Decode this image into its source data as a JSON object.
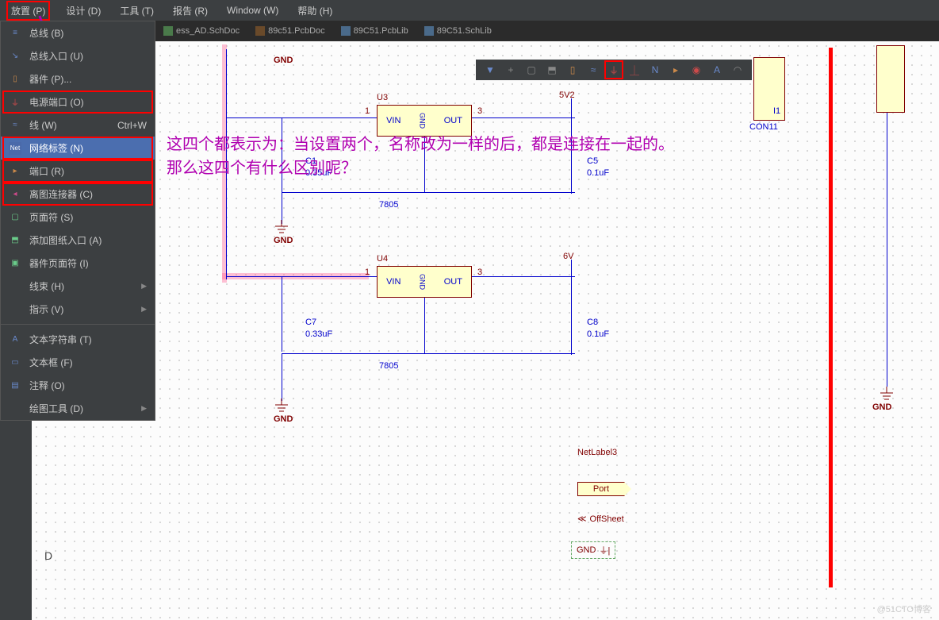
{
  "menubar": [
    {
      "label": "放置 (P)",
      "active": true
    },
    {
      "label": "设计 (D)"
    },
    {
      "label": "工具 (T)"
    },
    {
      "label": "报告 (R)"
    },
    {
      "label": "Window (W)"
    },
    {
      "label": "帮助 (H)"
    }
  ],
  "tabs": [
    {
      "label": "ess_AD.SchDoc",
      "icon": "sch"
    },
    {
      "label": "89c51.PcbDoc",
      "icon": "pcb"
    },
    {
      "label": "89C51.PcbLib",
      "icon": "lib"
    },
    {
      "label": "89C51.SchLib",
      "icon": "lib"
    }
  ],
  "dropdown": [
    {
      "label": "总线 (B)",
      "icon": "bus-icon"
    },
    {
      "label": "总线入口 (U)",
      "icon": "bus-entry-icon"
    },
    {
      "label": "器件 (P)...",
      "icon": "part-icon"
    },
    {
      "label": "电源端口 (O)",
      "icon": "power-port-icon",
      "redbox": true
    },
    {
      "label": "线 (W)",
      "shortcut": "Ctrl+W",
      "icon": "wire-icon"
    },
    {
      "label": "网络标签 (N)",
      "icon": "net-label-icon",
      "highlighted": true,
      "redbox": true
    },
    {
      "label": "端口 (R)",
      "icon": "port-icon",
      "redbox": true
    },
    {
      "label": "离图连接器 (C)",
      "icon": "offsheet-icon",
      "redbox": true
    },
    {
      "label": "页面符 (S)",
      "icon": "sheet-symbol-icon"
    },
    {
      "label": "添加图纸入口 (A)",
      "icon": "sheet-entry-icon"
    },
    {
      "label": "器件页面符 (I)",
      "icon": "device-sheet-icon"
    },
    {
      "label": "线束 (H)",
      "icon": "harness-icon",
      "sub": true
    },
    {
      "label": "指示 (V)",
      "icon": "directive-icon",
      "sub": true
    },
    {
      "sep": true
    },
    {
      "label": "文本字符串 (T)",
      "icon": "text-string-icon"
    },
    {
      "label": "文本框 (F)",
      "icon": "text-frame-icon"
    },
    {
      "label": "注释 (O)",
      "icon": "note-icon"
    },
    {
      "label": "绘图工具 (D)",
      "icon": "drawing-tools-icon",
      "sub": true
    }
  ],
  "schematic": {
    "gnd_top": "GND",
    "u3": {
      "ref": "U3",
      "pins": {
        "vin": "VIN",
        "out": "OUT",
        "gnd": "GND"
      },
      "pin1": "1",
      "pin3": "3",
      "value": "7805"
    },
    "u4": {
      "ref": "U4",
      "pins": {
        "vin": "VIN",
        "out": "OUT",
        "gnd": "GND"
      },
      "pin1": "1",
      "pin3": "3",
      "value": "7805"
    },
    "c1": {
      "ref": "C1",
      "value": "0.35uF"
    },
    "c5": {
      "ref": "C5",
      "value": "0.1uF"
    },
    "c7": {
      "ref": "C7",
      "value": "0.33uF"
    },
    "c8": {
      "ref": "C8",
      "value": "0.1uF"
    },
    "pwr_5v2": "5V2",
    "pwr_6v": "6V",
    "gnd1": "GND",
    "gnd2": "GND",
    "gnd3": "GND",
    "con11": {
      "ref": "CON11",
      "i1": "I1"
    },
    "netlabel3": "NetLabel3",
    "port_text": "Port",
    "offsheet_text": "OffSheet",
    "gnd_ex": "GND"
  },
  "annotation": {
    "line1": "这四个都表示为：当设置两个，名称改为一样的后，都是连接在一起的。",
    "line2": "那么这四个有什么区别呢？"
  },
  "row_letter": "D",
  "watermark": "@51CTO博客"
}
